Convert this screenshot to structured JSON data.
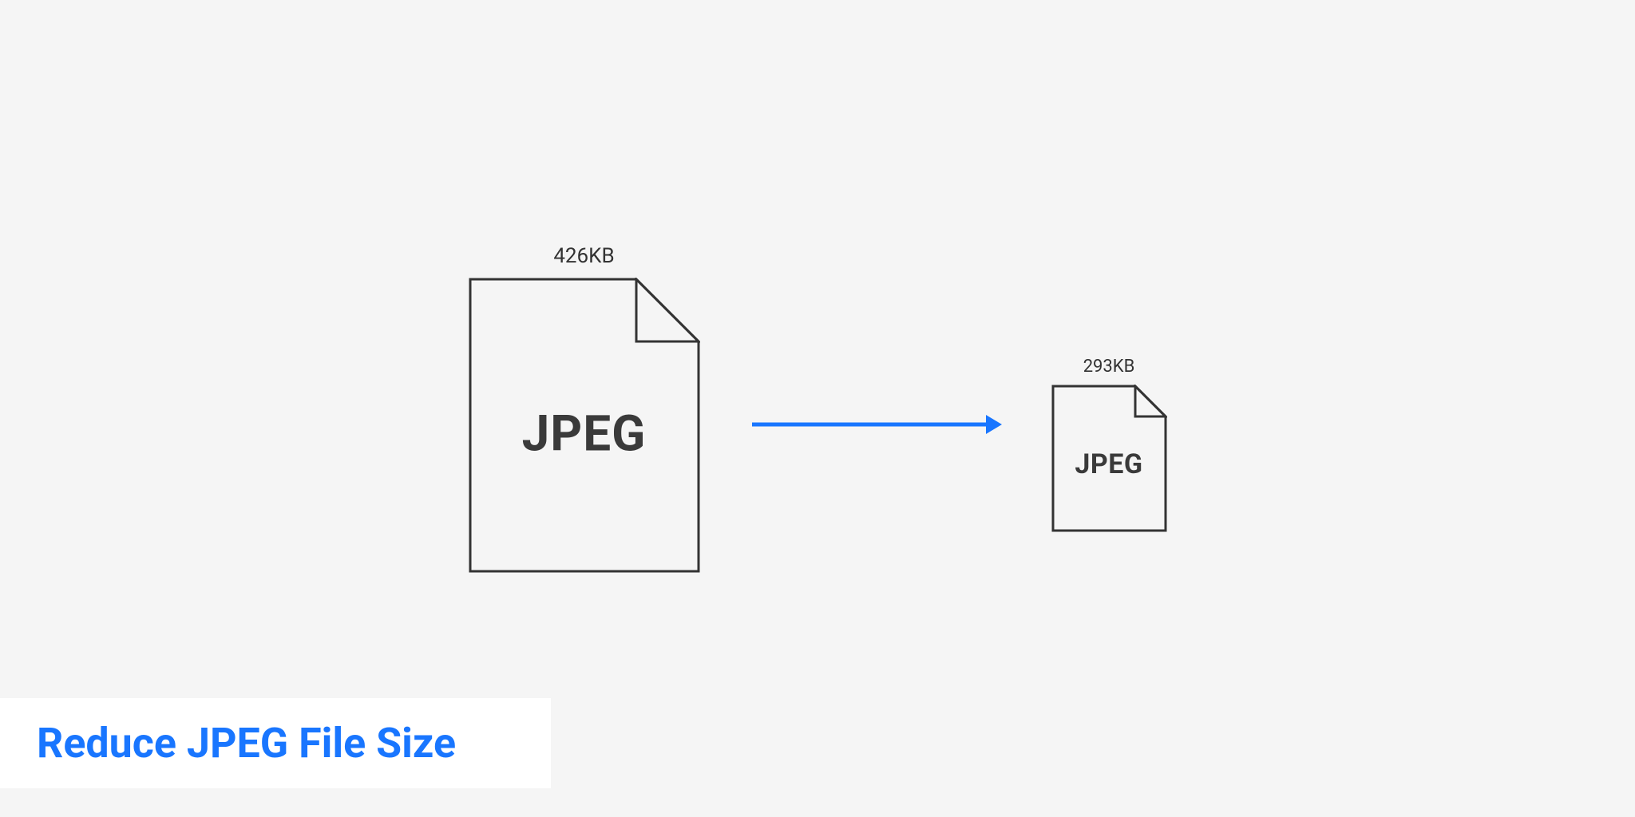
{
  "source": {
    "size_label": "426KB",
    "format_label": "JPEG"
  },
  "target": {
    "size_label": "293KB",
    "format_label": "JPEG"
  },
  "title": "Reduce JPEG File Size",
  "colors": {
    "accent": "#1976ff",
    "stroke": "#333333",
    "background": "#f5f5f5"
  }
}
